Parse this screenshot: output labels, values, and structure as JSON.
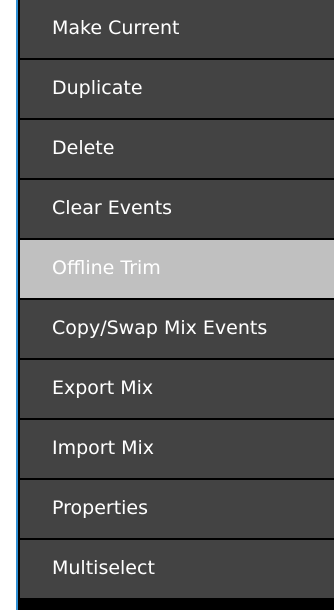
{
  "context_menu": {
    "items": [
      {
        "label": "Make Current",
        "highlighted": false
      },
      {
        "label": "Duplicate",
        "highlighted": false
      },
      {
        "label": "Delete",
        "highlighted": false
      },
      {
        "label": "Clear Events",
        "highlighted": false
      },
      {
        "label": "Offline Trim",
        "highlighted": true
      },
      {
        "label": "Copy/Swap Mix Events",
        "highlighted": false
      },
      {
        "label": "Export Mix",
        "highlighted": false
      },
      {
        "label": "Import Mix",
        "highlighted": false
      },
      {
        "label": "Properties",
        "highlighted": false
      },
      {
        "label": "Multiselect",
        "highlighted": false
      }
    ],
    "colors": {
      "item_background": "#434343",
      "highlight_background": "#c0c0c0",
      "text": "#ffffff",
      "border_accent": "#2e8fd4"
    }
  }
}
